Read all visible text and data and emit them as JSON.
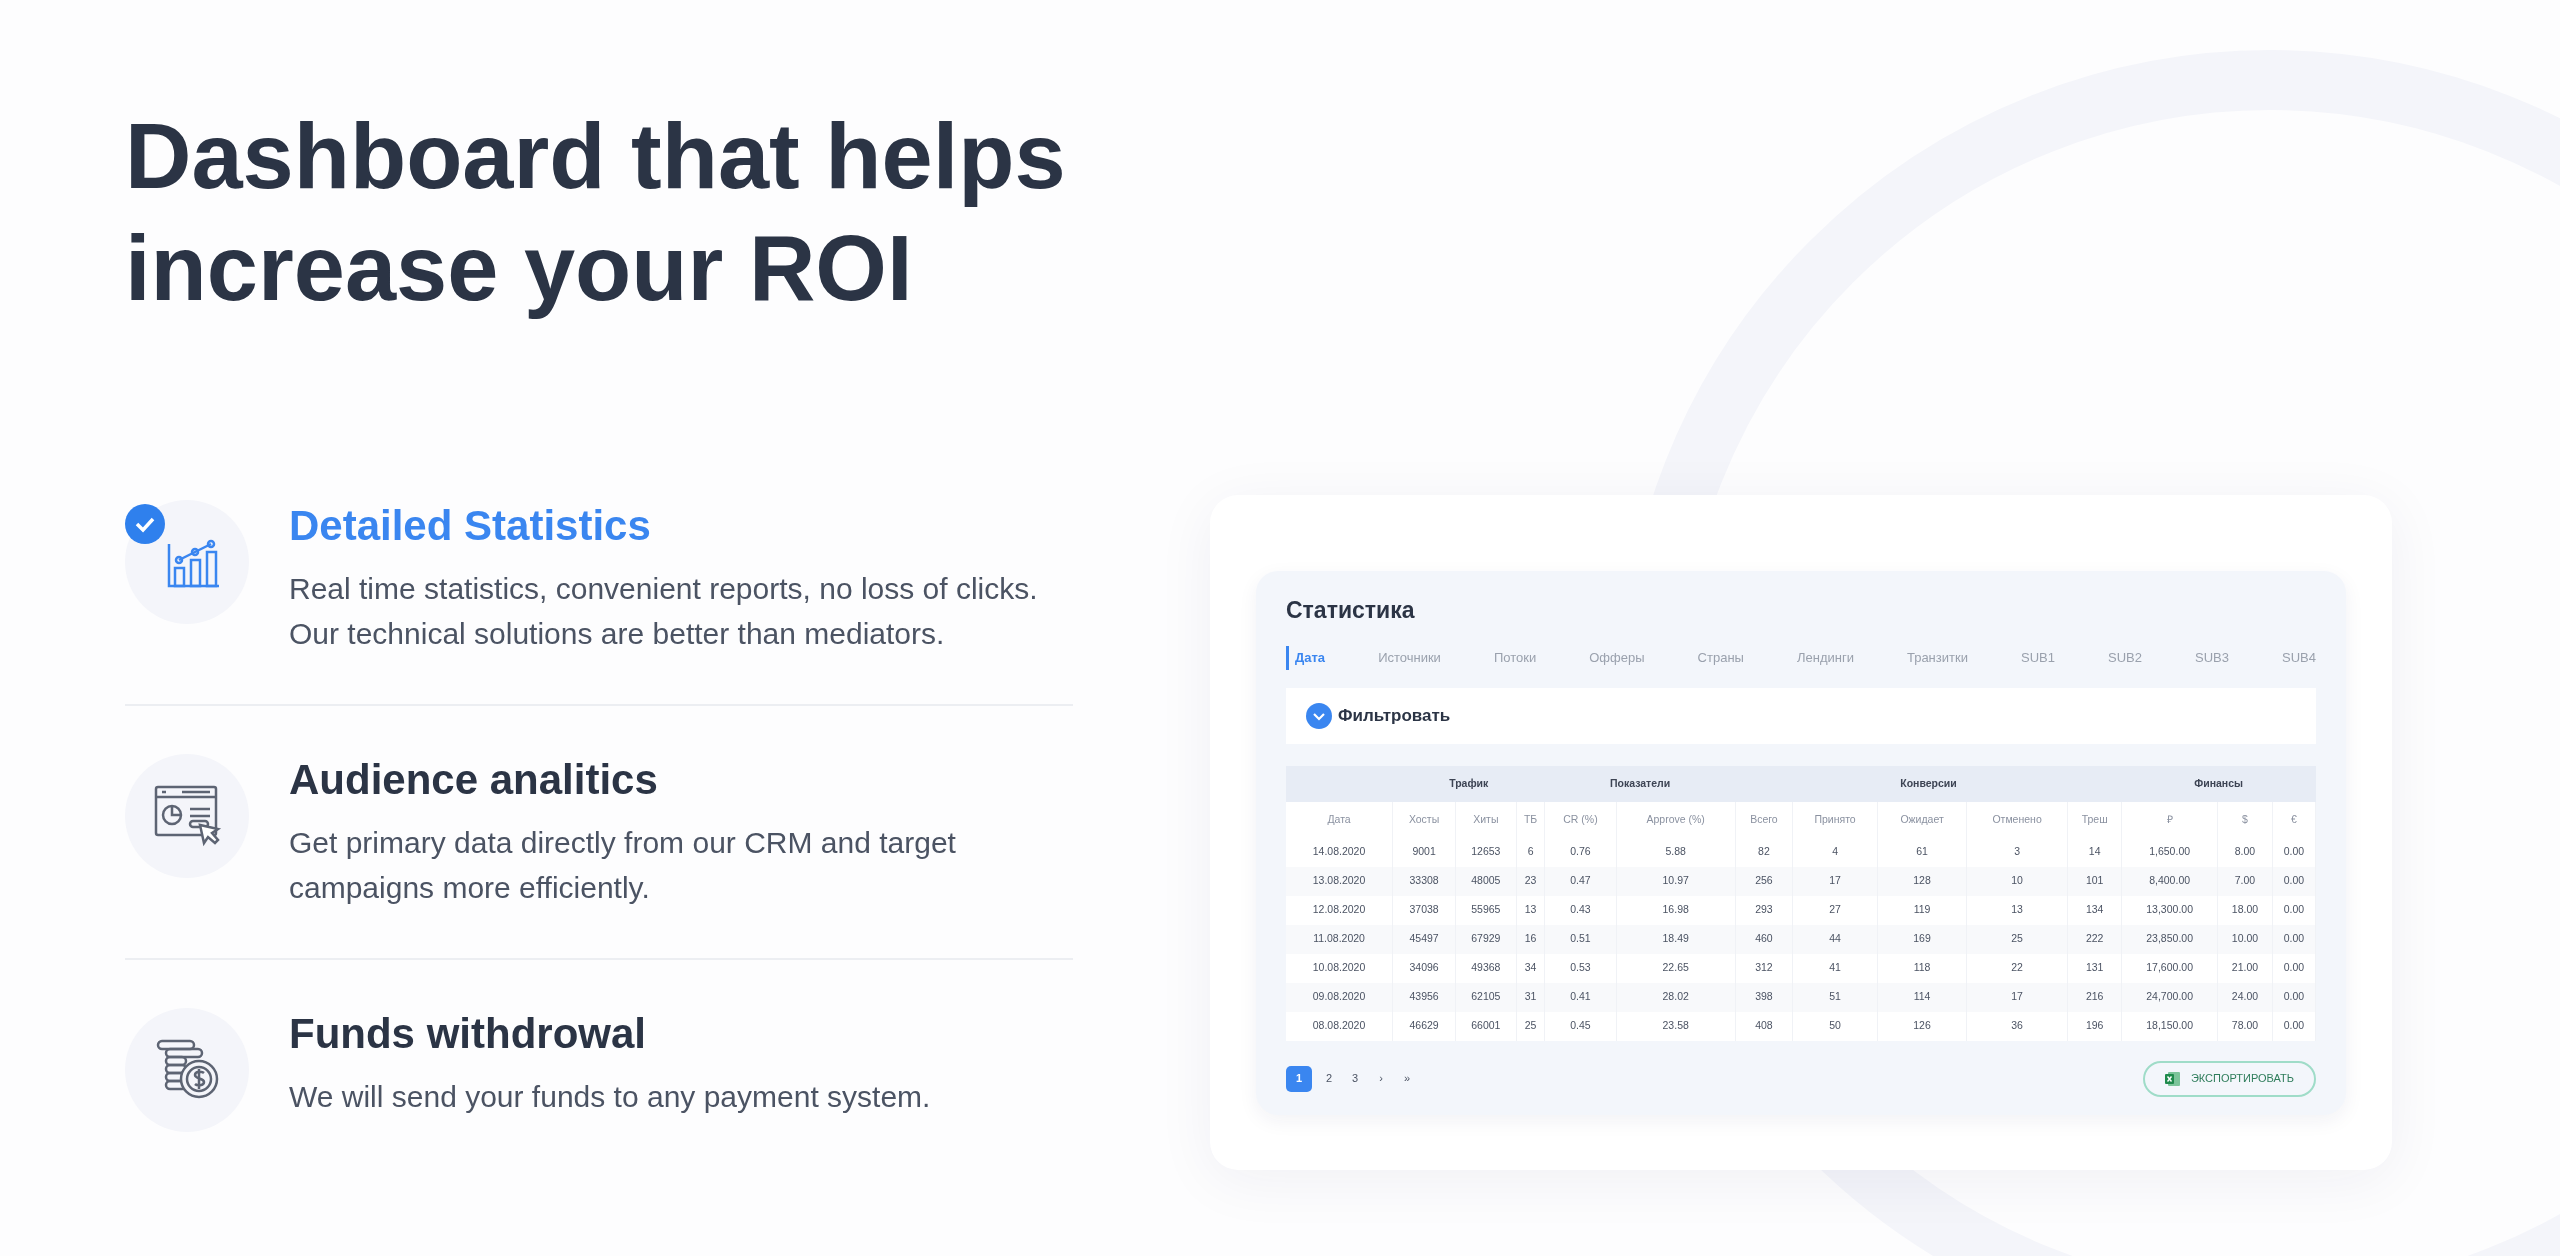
{
  "heading": "Dashboard that helps increase your ROI",
  "features": [
    {
      "kind": "statistics",
      "title": "Detailed Statistics",
      "text": "Real time statistics, convenient reports, no loss of clicks. Our technical solutions are better than mediators.",
      "selected": true
    },
    {
      "kind": "audience",
      "title": "Audience analitics",
      "text": "Get primary data directly from our CRM and target campaigns more efficiently.",
      "selected": false
    },
    {
      "kind": "funds",
      "title": "Funds withdrowal",
      "text": "We will send your funds to any payment system.",
      "selected": false
    }
  ],
  "dashboard": {
    "title": "Статистика",
    "tabs": [
      {
        "label": "Дата",
        "selected": true
      },
      {
        "label": "Источники",
        "selected": false
      },
      {
        "label": "Потоки",
        "selected": false
      },
      {
        "label": "Офферы",
        "selected": false
      },
      {
        "label": "Страны",
        "selected": false
      },
      {
        "label": "Лендинги",
        "selected": false
      },
      {
        "label": "Транзитки",
        "selected": false
      },
      {
        "label": "SUB1",
        "selected": false
      },
      {
        "label": "SUB2",
        "selected": false
      },
      {
        "label": "SUB3",
        "selected": false
      },
      {
        "label": "SUB4",
        "selected": false
      }
    ],
    "filter": "Фильтровать",
    "table": {
      "groups": [
        {
          "columns": [
            "Дата"
          ]
        },
        {
          "label": "Трафик",
          "columns": [
            "Хосты",
            "Хиты",
            "ТБ"
          ]
        },
        {
          "label": "Показатели",
          "columns": [
            "CR (%)",
            "Approve (%)"
          ]
        },
        {
          "label": "Конверсии",
          "columns": [
            "Всего",
            "Принято",
            "Ожидает",
            "Отменено",
            "Треш"
          ]
        },
        {
          "label": "Финансы",
          "columns": [
            "₽",
            "$",
            "€"
          ]
        }
      ],
      "rows": [
        [
          "14.08.2020",
          "9001",
          "12653",
          "6",
          "0.76",
          "5.88",
          "82",
          "4",
          "61",
          "3",
          "14",
          "1,650.00",
          "8.00",
          "0.00"
        ],
        [
          "13.08.2020",
          "33308",
          "48005",
          "23",
          "0.47",
          "10.97",
          "256",
          "17",
          "128",
          "10",
          "101",
          "8,400.00",
          "7.00",
          "0.00"
        ],
        [
          "12.08.2020",
          "37038",
          "55965",
          "13",
          "0.43",
          "16.98",
          "293",
          "27",
          "119",
          "13",
          "134",
          "13,300.00",
          "18.00",
          "0.00"
        ],
        [
          "11.08.2020",
          "45497",
          "67929",
          "16",
          "0.51",
          "18.49",
          "460",
          "44",
          "169",
          "25",
          "222",
          "23,850.00",
          "10.00",
          "0.00"
        ],
        [
          "10.08.2020",
          "34096",
          "49368",
          "34",
          "0.53",
          "22.65",
          "312",
          "41",
          "118",
          "22",
          "131",
          "17,600.00",
          "21.00",
          "0.00"
        ],
        [
          "09.08.2020",
          "43956",
          "62105",
          "31",
          "0.41",
          "28.02",
          "398",
          "51",
          "114",
          "17",
          "216",
          "24,700.00",
          "24.00",
          "0.00"
        ],
        [
          "08.08.2020",
          "46629",
          "66001",
          "25",
          "0.45",
          "23.58",
          "408",
          "50",
          "126",
          "36",
          "196",
          "18,150.00",
          "78.00",
          "0.00"
        ]
      ]
    },
    "pages": [
      {
        "label": "1",
        "selected": true
      },
      {
        "label": "2",
        "selected": false
      },
      {
        "label": "3",
        "selected": false
      },
      {
        "label": "›",
        "selected": false
      },
      {
        "label": "»",
        "selected": false
      }
    ],
    "export": "ЭКСПОРТИРОВАТЬ"
  }
}
